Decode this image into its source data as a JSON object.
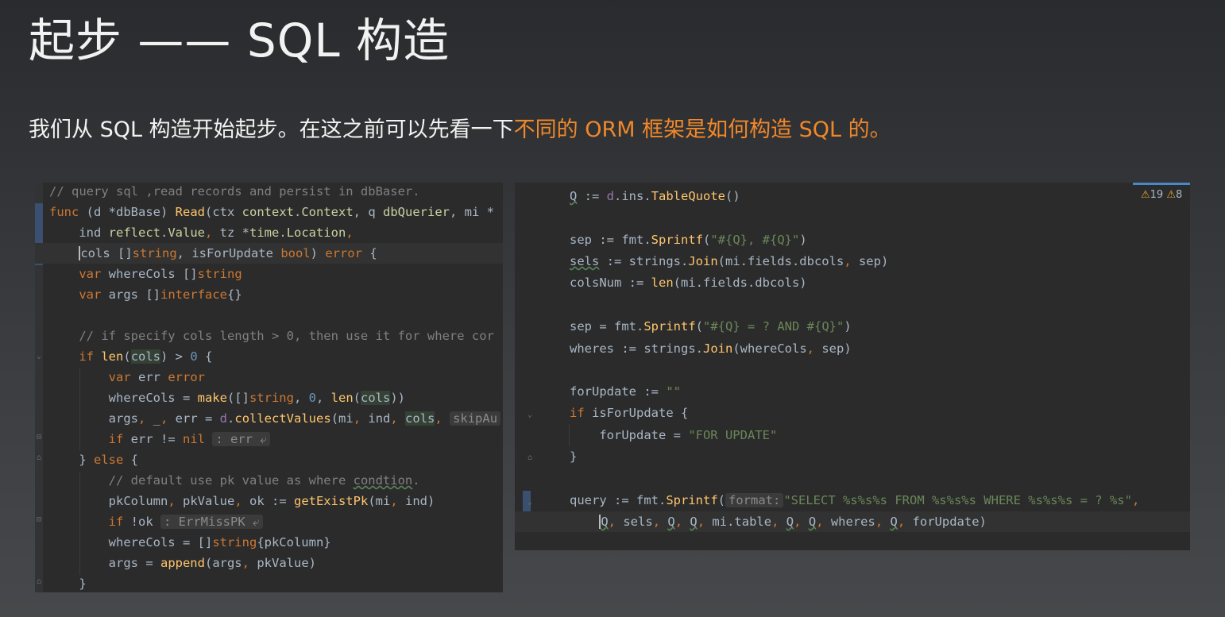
{
  "slide": {
    "title": "起步 —— SQL 构造",
    "subtitle_plain": "我们从 SQL 构造开始起步。在这之前可以先看一下",
    "subtitle_highlight": "不同的 ORM 框架是如何构造 SQL 的。"
  },
  "colors": {
    "highlight": "#f0882a",
    "editor_bg": "#2b2b2b",
    "keyword": "#cc7832",
    "function": "#ffc66d",
    "string": "#6a8759",
    "comment": "#808080"
  },
  "left_code": {
    "lines": [
      "// query sql ,read records and persist in dbBaser.",
      "func (d *dbBase) Read(ctx context.Context, q dbQuerier, mi *",
      "    ind reflect.Value, tz *time.Location,",
      "    cols []string, isForUpdate bool) error {",
      "    var whereCols []string",
      "    var args []interface{}",
      "",
      "    // if specify cols length > 0, then use it for where cor",
      "    if len(cols) > 0 {",
      "        var err error",
      "        whereCols = make([]string, 0, len(cols))",
      "        args, _, err = d.collectValues(mi, ind, cols, skipAu",
      "        if err != nil : err ⤶",
      "    } else {",
      "        // default use pk value as where condtion.",
      "        pkColumn, pkValue, ok := getExistPk(mi, ind)",
      "        if !ok : ErrMissPK ⤶",
      "        whereCols = []string{pkColumn}",
      "        args = append(args, pkValue)",
      "    }"
    ]
  },
  "right_code": {
    "warnings_count": "19",
    "errors_count": "8",
    "lines": [
      "Q := d.ins.TableQuote()",
      "",
      "sep := fmt.Sprintf(\"#{Q}, #{Q}\")",
      "sels := strings.Join(mi.fields.dbcols, sep)",
      "colsNum := len(mi.fields.dbcols)",
      "",
      "sep = fmt.Sprintf(\"#{Q} = ? AND #{Q}\")",
      "wheres := strings.Join(whereCols, sep)",
      "",
      "forUpdate := \"\"",
      "if isForUpdate {",
      "    forUpdate = \"FOR UPDATE\"",
      "}",
      "",
      "query := fmt.Sprintf( format: \"SELECT %s%s%s FROM %s%s%s WHERE %s%s%s = ? %s\",",
      "    Q, sels, Q, Q, mi.table, Q, Q, wheres, Q, forUpdate)"
    ]
  }
}
